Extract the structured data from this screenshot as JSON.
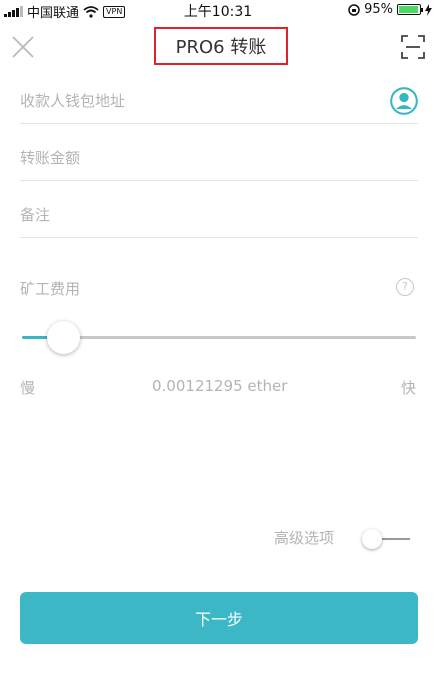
{
  "status_bar": {
    "carrier": "中国联通",
    "vpn": "VPN",
    "time": "上午10:31",
    "battery_percent": "95%",
    "battery_level": 0.95
  },
  "nav": {
    "title": "PRO6 转账",
    "close_icon": "close-icon",
    "scan_icon": "scan-icon"
  },
  "form": {
    "recipient_placeholder": "收款人钱包地址",
    "amount_placeholder": "转账金额",
    "note_placeholder": "备注",
    "contact_icon": "contact-icon"
  },
  "fee": {
    "label": "矿工费用",
    "help_icon": "?",
    "slider_level": 0.07,
    "slow_label": "慢",
    "fast_label": "快",
    "value": "0.00121295 ether"
  },
  "advanced": {
    "label": "高级选项",
    "enabled": false
  },
  "actions": {
    "next_label": "下一步"
  },
  "colors": {
    "accent": "#3bb7c6",
    "highlight_border": "#e0232b",
    "placeholder": "#b4b4b4"
  }
}
